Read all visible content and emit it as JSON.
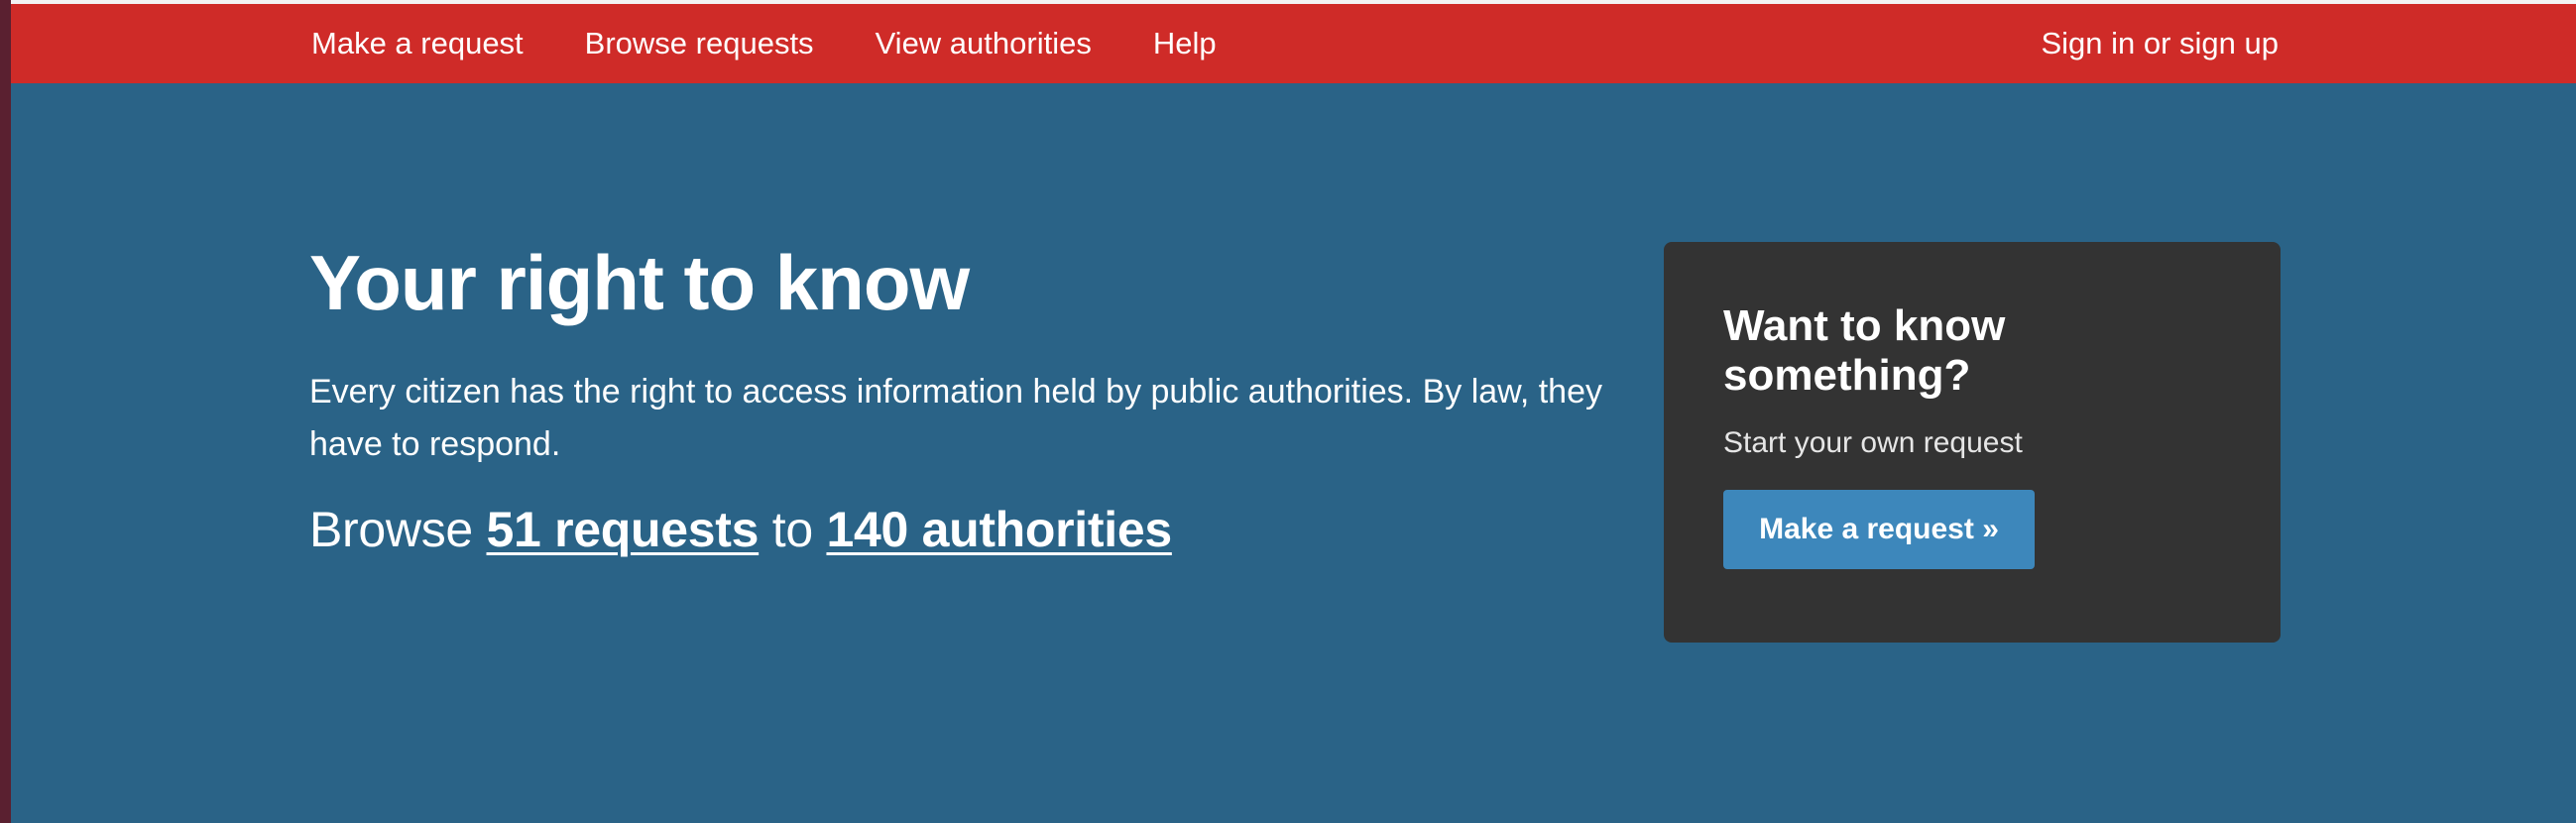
{
  "nav": {
    "items": [
      {
        "label": "Make a request"
      },
      {
        "label": "Browse requests"
      },
      {
        "label": "View authorities"
      },
      {
        "label": "Help"
      }
    ],
    "signin_label": "Sign in or sign up"
  },
  "hero": {
    "title": "Your right to know",
    "text": "Every citizen has the right to access information held by public authorities. By law, they have to respond.",
    "browse_prefix": "Browse ",
    "requests_link": "51 requests",
    "browse_middle": " to ",
    "authorities_link": "140 authorities"
  },
  "card": {
    "title": "Want to know something?",
    "subtitle": "Start your own request",
    "button_label": "Make a request »"
  },
  "colors": {
    "topbar": "#cf2b28",
    "hero_background": "#2a6387",
    "card_background": "#333333",
    "button_background": "#3d87bb"
  }
}
